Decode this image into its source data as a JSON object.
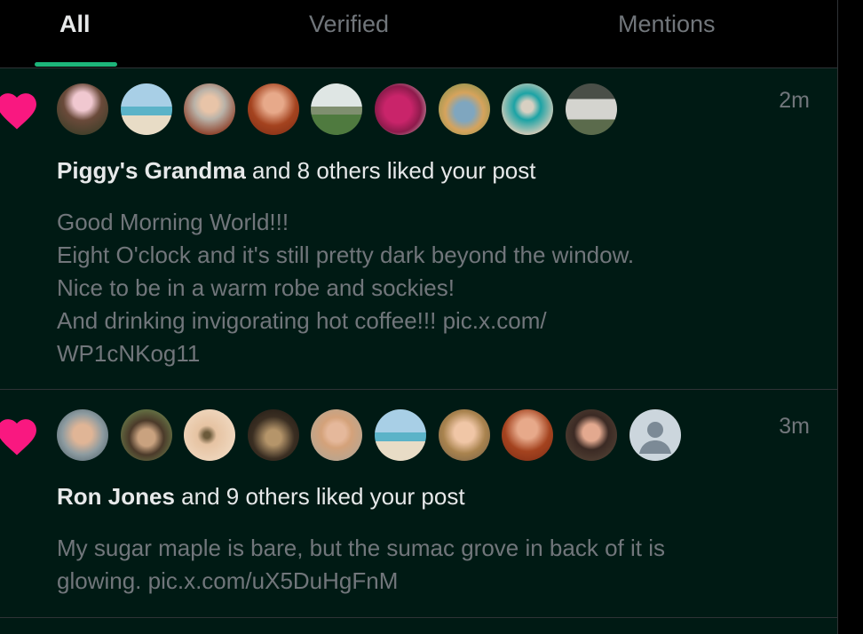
{
  "tabs": [
    {
      "label": "All",
      "active": true
    },
    {
      "label": "Verified",
      "active": false
    },
    {
      "label": "Mentions",
      "active": false
    }
  ],
  "colors": {
    "accent": "#1db57a",
    "heart": "#f91880",
    "background": "#001a14"
  },
  "notifications": [
    {
      "icon": "heart-icon",
      "time": "2m",
      "actor": "Piggy's Grandma",
      "action": "and 8 others liked your post",
      "avatar_count": 9,
      "post_lines": [
        "Good Morning World!!!",
        "Eight O'clock and it's still pretty dark beyond the window.",
        "Nice to be in a warm robe and sockies!",
        "And drinking invigorating hot coffee!!! pic.x.com/",
        "WP1cNKog11"
      ]
    },
    {
      "icon": "heart-icon",
      "time": "3m",
      "actor": "Ron Jones",
      "action": "and 9 others liked your post",
      "avatar_count": 10,
      "post_lines": [
        "My sugar maple is bare, but the sumac grove in back of it is",
        "glowing. pic.x.com/uX5DuHgFnM"
      ]
    }
  ]
}
